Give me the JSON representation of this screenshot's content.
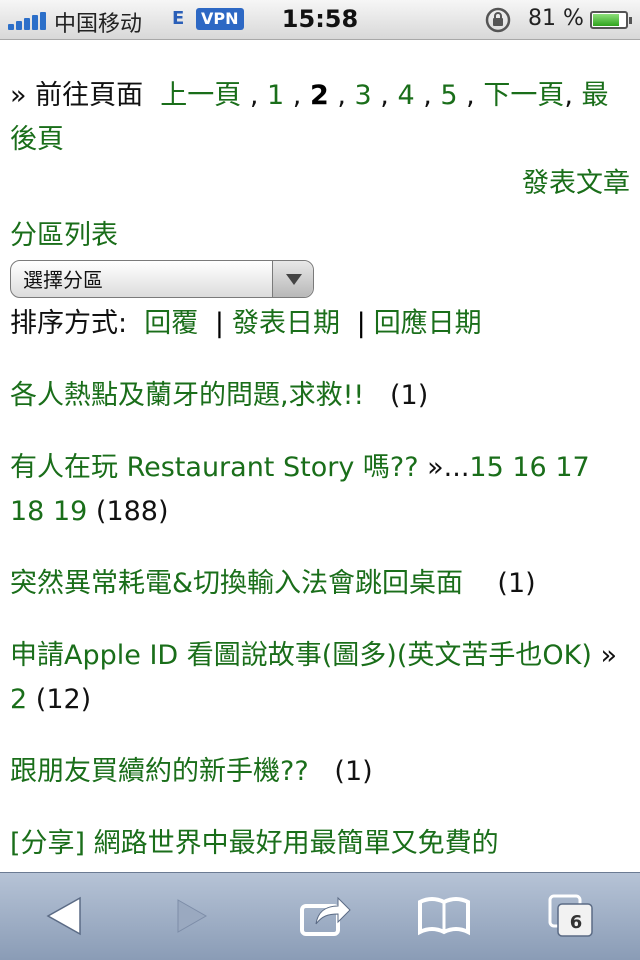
{
  "status": {
    "carrier": "中国移动",
    "network": "E",
    "vpn": "VPN",
    "time": "15:58",
    "battery_pct": "81 %",
    "battery_level": 0.81
  },
  "pager": {
    "prefix": "» 前往頁面",
    "prev": "上一頁",
    "pages": [
      "1",
      "2",
      "3",
      "4",
      "5"
    ],
    "current": "2",
    "next": "下一頁",
    "last": "最後頁"
  },
  "post_article": "發表文章",
  "forum": {
    "label": "分區列表",
    "select_value": "選擇分區"
  },
  "sort": {
    "label": "排序方式:",
    "options": [
      "回覆",
      "發表日期",
      "回應日期"
    ]
  },
  "threads": [
    {
      "title": "各人熱點及蘭牙的問題,求救!!",
      "count": "(1)"
    },
    {
      "title": "有人在玩 Restaurant Story 嗎??",
      "pages_prefix": "»...",
      "pages": [
        "15",
        "16",
        "17",
        "18",
        "19"
      ],
      "count": "(188)"
    },
    {
      "title": "突然異常耗電&切換輸入法會跳回桌面",
      "count": "(1)"
    },
    {
      "title": "申請Apple ID 看圖說故事(圖多)(英文苦手也OK)",
      "pages_prefix": "»",
      "pages": [
        "2"
      ],
      "count": "(12)"
    },
    {
      "title": "跟朋友買續約的新手機??",
      "count": "(1)"
    },
    {
      "title": "[分享] 網路世界中最好用最簡單又免費的",
      "count": ""
    }
  ],
  "toolbar": {
    "tabs_count": "6"
  },
  "colors": {
    "link": "#1a6e1a",
    "toolbar": "#8a9cb6"
  }
}
